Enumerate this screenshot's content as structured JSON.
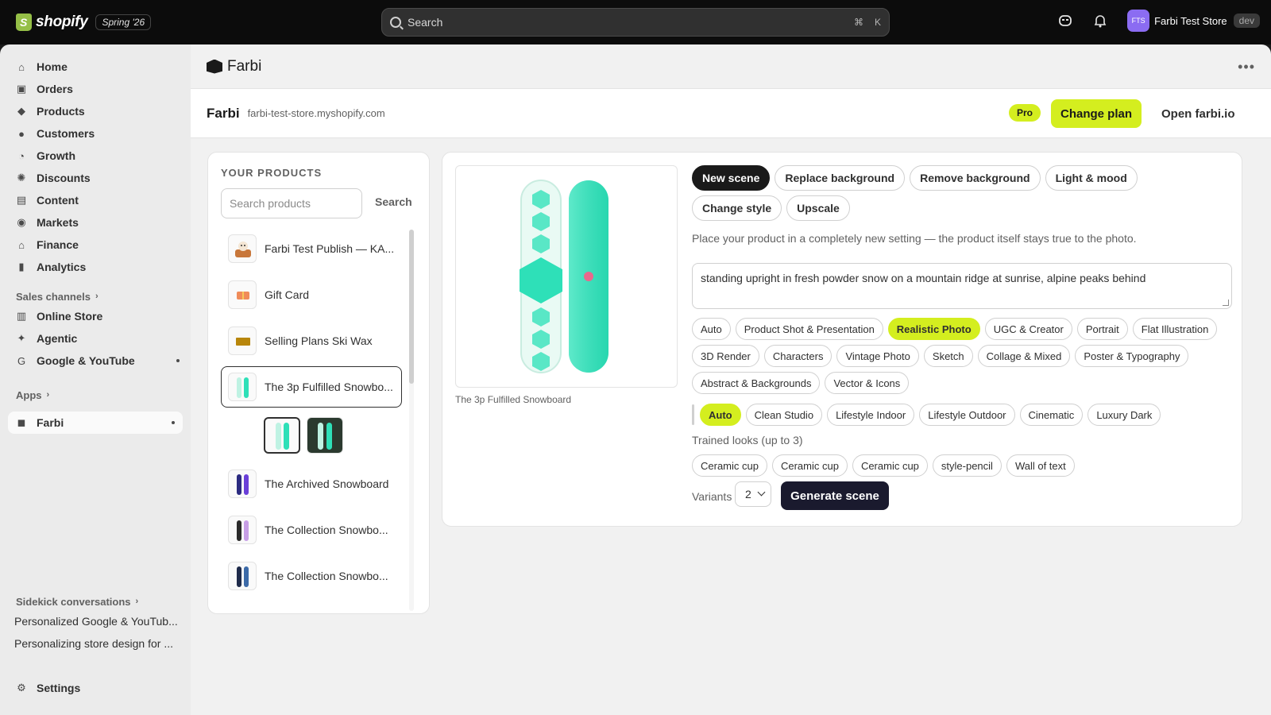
{
  "topbar": {
    "brand": "shopify",
    "edition": "Spring '26",
    "search_placeholder": "Search",
    "shortcut_cmd": "⌘",
    "shortcut_key": "K",
    "avatar_initials": "FTS",
    "store_name": "Farbi Test Store",
    "env_badge": "dev"
  },
  "sidebar": {
    "items": [
      {
        "label": "Home",
        "icon": "home-icon"
      },
      {
        "label": "Orders",
        "icon": "orders-icon"
      },
      {
        "label": "Products",
        "icon": "tag-icon"
      },
      {
        "label": "Customers",
        "icon": "person-icon"
      },
      {
        "label": "Growth",
        "icon": "growth-icon"
      },
      {
        "label": "Discounts",
        "icon": "discount-icon"
      },
      {
        "label": "Content",
        "icon": "content-icon"
      },
      {
        "label": "Markets",
        "icon": "globe-icon"
      },
      {
        "label": "Finance",
        "icon": "bank-icon"
      },
      {
        "label": "Analytics",
        "icon": "chart-icon"
      }
    ],
    "sales_channels_label": "Sales channels",
    "channels": [
      {
        "label": "Online Store"
      },
      {
        "label": "Agentic"
      },
      {
        "label": "Google & YouTube"
      }
    ],
    "apps_label": "Apps",
    "apps": [
      {
        "label": "Farbi"
      }
    ],
    "sidekick_label": "Sidekick conversations",
    "sidekick": [
      {
        "label": "Personalized Google & YouTub..."
      },
      {
        "label": "Personalizing store design for ..."
      }
    ],
    "settings_label": "Settings"
  },
  "app": {
    "name": "Farbi",
    "store_title": "Farbi",
    "store_domain": "farbi-test-store.myshopify.com",
    "plan_badge": "Pro",
    "change_plan": "Change plan",
    "open_site": "Open farbi.io"
  },
  "products": {
    "title": "YOUR PRODUCTS",
    "search_placeholder": "Search products",
    "search_button": "Search",
    "items": [
      {
        "name": "Farbi Test Publish — KA..."
      },
      {
        "name": "Gift Card"
      },
      {
        "name": "Selling Plans Ski Wax"
      },
      {
        "name": "The 3p Fulfilled Snowbo...",
        "selected": true
      },
      {
        "name": "The Archived Snowboard"
      },
      {
        "name": "The Collection Snowbo..."
      },
      {
        "name": "The Collection Snowbo..."
      }
    ]
  },
  "editor": {
    "preview_caption": "The 3p Fulfilled Snowboard",
    "modes": [
      {
        "label": "New scene",
        "active": true
      },
      {
        "label": "Replace background"
      },
      {
        "label": "Remove background"
      },
      {
        "label": "Light & mood"
      },
      {
        "label": "Change style"
      },
      {
        "label": "Upscale"
      }
    ],
    "description": "Place your product in a completely new setting — the product itself stays true to the photo.",
    "prompt": "standing upright in fresh powder snow on a mountain ridge at sunrise, alpine peaks behind",
    "styles": [
      {
        "label": "Auto"
      },
      {
        "label": "Product Shot & Presentation"
      },
      {
        "label": "Realistic Photo",
        "active": true
      },
      {
        "label": "UGC & Creator"
      },
      {
        "label": "Portrait"
      },
      {
        "label": "Flat Illustration"
      },
      {
        "label": "3D Render"
      },
      {
        "label": "Characters"
      },
      {
        "label": "Vintage Photo"
      },
      {
        "label": "Sketch"
      },
      {
        "label": "Collage & Mixed"
      },
      {
        "label": "Poster & Typography"
      },
      {
        "label": "Abstract & Backgrounds"
      },
      {
        "label": "Vector & Icons"
      }
    ],
    "looks": [
      {
        "label": "Auto",
        "active": true
      },
      {
        "label": "Clean Studio"
      },
      {
        "label": "Lifestyle Indoor"
      },
      {
        "label": "Lifestyle Outdoor"
      },
      {
        "label": "Cinematic"
      },
      {
        "label": "Luxury Dark"
      }
    ],
    "trained_label": "Trained looks (up to 3)",
    "trained": [
      {
        "label": "Ceramic cup"
      },
      {
        "label": "Ceramic cup"
      },
      {
        "label": "Ceramic cup"
      },
      {
        "label": "style-pencil"
      },
      {
        "label": "Wall of text"
      }
    ],
    "variants_label": "Variants",
    "variants_value": "2",
    "generate": "Generate scene"
  },
  "colors": {
    "accent": "#d4ee1f",
    "board_teal": "#2ee0b8",
    "dark": "#1a1a1a"
  }
}
